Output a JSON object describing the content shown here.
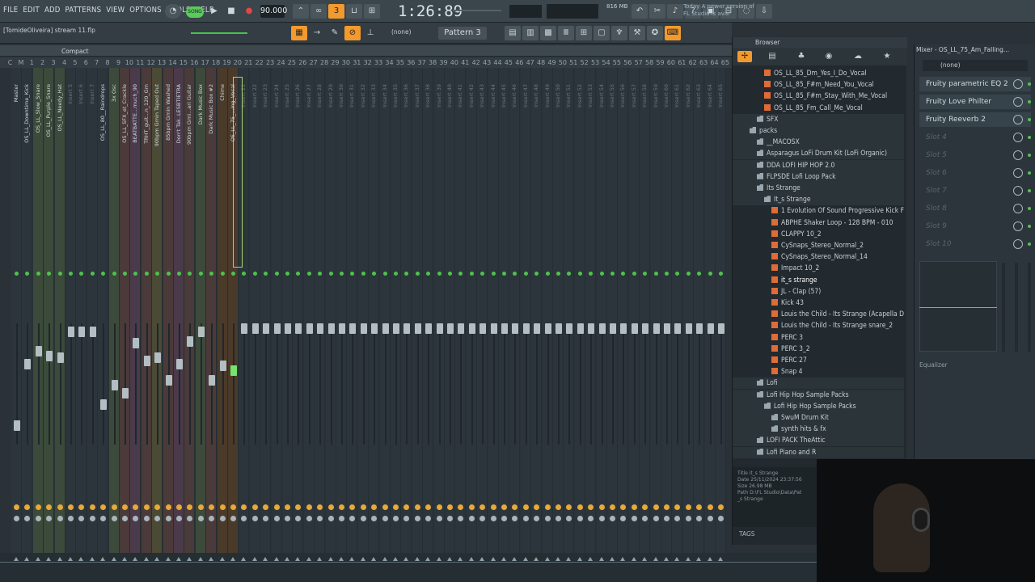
{
  "menu": [
    "FILE",
    "EDIT",
    "ADD",
    "PATTERNS",
    "VIEW",
    "OPTIONS",
    "TOOLS",
    "HELP"
  ],
  "transport": {
    "song_label": "SONG",
    "tempo": "90.000",
    "time": "1:26:89",
    "memory": "816 MB",
    "memory_sub": "0"
  },
  "news": {
    "line1": "Today  A newer version of",
    "line2": "FL Studio is avai"
  },
  "hint": "[TomideOliveira] stream 11.flp",
  "pattern": "Pattern 3",
  "snap": "(none)",
  "mixer": {
    "view": "Compact",
    "channel_numbers": [
      "C",
      "M",
      "1",
      "2",
      "3",
      "4",
      "5",
      "6",
      "7",
      "8",
      "9",
      "10",
      "11",
      "12",
      "13",
      "14",
      "15",
      "16",
      "17",
      "18",
      "19",
      "20",
      "21",
      "22",
      "23",
      "24",
      "25",
      "26",
      "27",
      "28",
      "29",
      "30",
      "31",
      "32",
      "33",
      "34",
      "35",
      "36",
      "37",
      "38",
      "39",
      "40",
      "41",
      "42",
      "43",
      "44",
      "45",
      "46",
      "47",
      "48",
      "49",
      "50",
      "51",
      "52",
      "53",
      "54",
      "55",
      "56",
      "57",
      "58",
      "59",
      "60",
      "61",
      "62",
      "63",
      "64",
      "65"
    ],
    "channels": [
      "Master",
      "OS_LL_Downtime_Kick",
      "OS_LL_Slow_Snare",
      "OS_LL_Purple_Snare",
      "OS_LL_Needy_Hat",
      "Insert 5",
      "Insert 6",
      "Insert 7",
      "OS_LL_80__Raindrops",
      "3x Osc",
      "OS_LL_SFX_et_Crackle",
      "BEATBATTE...much_90",
      "TRHT_guit...n_120_Gm",
      "90bpm Gmin Taped Out",
      "85bpm Gmin Washed",
      "Don't Tak..LESBTIETRA",
      "90bpm Gmi...ari Guitar",
      "Dark Music Box",
      "Dark Music Box #2",
      "Chime",
      "OS_LL_75_...ing_Vocal",
      "Insert 21",
      "Insert 22",
      "Insert 23",
      "Insert 24",
      "Insert 25",
      "Insert 26",
      "Insert 27",
      "Insert 28",
      "Insert 29",
      "Insert 30",
      "Insert 31",
      "Insert 32",
      "Insert 33",
      "Insert 34",
      "Insert 35",
      "Insert 36",
      "Insert 37",
      "Insert 38",
      "Insert 39",
      "Insert 40",
      "Insert 41",
      "Insert 42",
      "Insert 43",
      "Insert 44",
      "Insert 45",
      "Insert 46",
      "Insert 47",
      "Insert 48",
      "Insert 49",
      "Insert 50",
      "Insert 51",
      "Insert 52",
      "Insert 53",
      "Insert 54",
      "Insert 55",
      "Insert 56",
      "Insert 57",
      "Insert 58",
      "Insert 59",
      "Insert 60",
      "Insert 61",
      "Insert 62",
      "Insert 63",
      "Insert 64",
      "Insert 65"
    ]
  },
  "browser": {
    "title": "Browser",
    "tree": [
      {
        "label": "OS_LL_85_Dm_Yes_I_Do_Vocal",
        "type": "file",
        "indent": 3
      },
      {
        "label": "OS_LL_85_F#m_Need_You_Vocal",
        "type": "file",
        "indent": 3
      },
      {
        "label": "OS_LL_85_F#m_Stay_With_Me_Vocal",
        "type": "file",
        "indent": 3
      },
      {
        "label": "OS_LL_85_Fm_Call_Me_Vocal",
        "type": "file",
        "indent": 3
      },
      {
        "label": "SFX",
        "type": "folder",
        "indent": 2
      },
      {
        "label": "packs",
        "type": "folder",
        "indent": 1
      },
      {
        "label": "__MACOSX",
        "type": "folder",
        "indent": 2
      },
      {
        "label": "Asparagus LoFi Drum Kit (LoFi Organic)",
        "type": "folder",
        "indent": 2
      },
      {
        "label": "DDA LOFI HIP HOP 2.0",
        "type": "folder",
        "indent": 2
      },
      {
        "label": "FLPSDE Lofi Loop Pack",
        "type": "folder",
        "indent": 2
      },
      {
        "label": "Its Strange",
        "type": "folder",
        "indent": 2
      },
      {
        "label": "It_s Strange",
        "type": "folder",
        "indent": 3
      },
      {
        "label": "1 Evolution Of Sound Progressive Kick F#",
        "type": "file",
        "indent": 4
      },
      {
        "label": "ABPHE Shaker Loop - 128 BPM - 010",
        "type": "file",
        "indent": 4
      },
      {
        "label": "CLAPPY 10_2",
        "type": "file",
        "indent": 4
      },
      {
        "label": "CySnaps_Stereo_Normal_2",
        "type": "file",
        "indent": 4
      },
      {
        "label": "CySnaps_Stereo_Normal_14",
        "type": "file",
        "indent": 4
      },
      {
        "label": "Impact 10_2",
        "type": "file",
        "indent": 4
      },
      {
        "label": "it_s strange",
        "type": "file",
        "indent": 4,
        "hl": true
      },
      {
        "label": "JL - Clap  (57)",
        "type": "file",
        "indent": 4
      },
      {
        "label": "Kick 43",
        "type": "file",
        "indent": 4
      },
      {
        "label": "Louis the Child - Its Strange (Acapella DIY)",
        "type": "file",
        "indent": 4
      },
      {
        "label": "Louis the Child - Its Strange snare_2",
        "type": "file",
        "indent": 4
      },
      {
        "label": "PERC 3",
        "type": "file",
        "indent": 4
      },
      {
        "label": "PERC 3_2",
        "type": "file",
        "indent": 4
      },
      {
        "label": "PERC 27",
        "type": "file",
        "indent": 4
      },
      {
        "label": "Snap 4",
        "type": "file",
        "indent": 4
      },
      {
        "label": "Lofi",
        "type": "folder",
        "indent": 2
      },
      {
        "label": "Lofi Hip Hop Sample Packs",
        "type": "folder",
        "indent": 2
      },
      {
        "label": "Lofi Hip Hop Sample Packs",
        "type": "folder",
        "indent": 3
      },
      {
        "label": "SwuM Drum Kit",
        "type": "folder",
        "indent": 4
      },
      {
        "label": "synth hits & fx",
        "type": "folder",
        "indent": 4
      },
      {
        "label": "LOFI PACK TheAttic",
        "type": "folder",
        "indent": 2
      },
      {
        "label": "Lofi Piano and R",
        "type": "folder",
        "indent": 2
      }
    ],
    "info": {
      "title": "Title   it_s Strange",
      "date": "Date    25/11/2024 23:37:56",
      "size": "Size    26.98 MB",
      "path": "Path    D:\\FL Studio\\Data\\Pat",
      "path2": "          _s Strange"
    },
    "tags_label": "TAGS"
  },
  "mixer_track": {
    "title": "Mixer - OS_LL_75_Am_Falling...",
    "input": "(none)",
    "slots": [
      "Fruity parametric EQ 2",
      "Fruity Love Philter",
      "Fruity Reeverb 2",
      "Slot 4",
      "Slot 5",
      "Slot 6",
      "Slot 7",
      "Slot 8",
      "Slot 9",
      "Slot 10"
    ],
    "eq_label": "Equalizer"
  }
}
